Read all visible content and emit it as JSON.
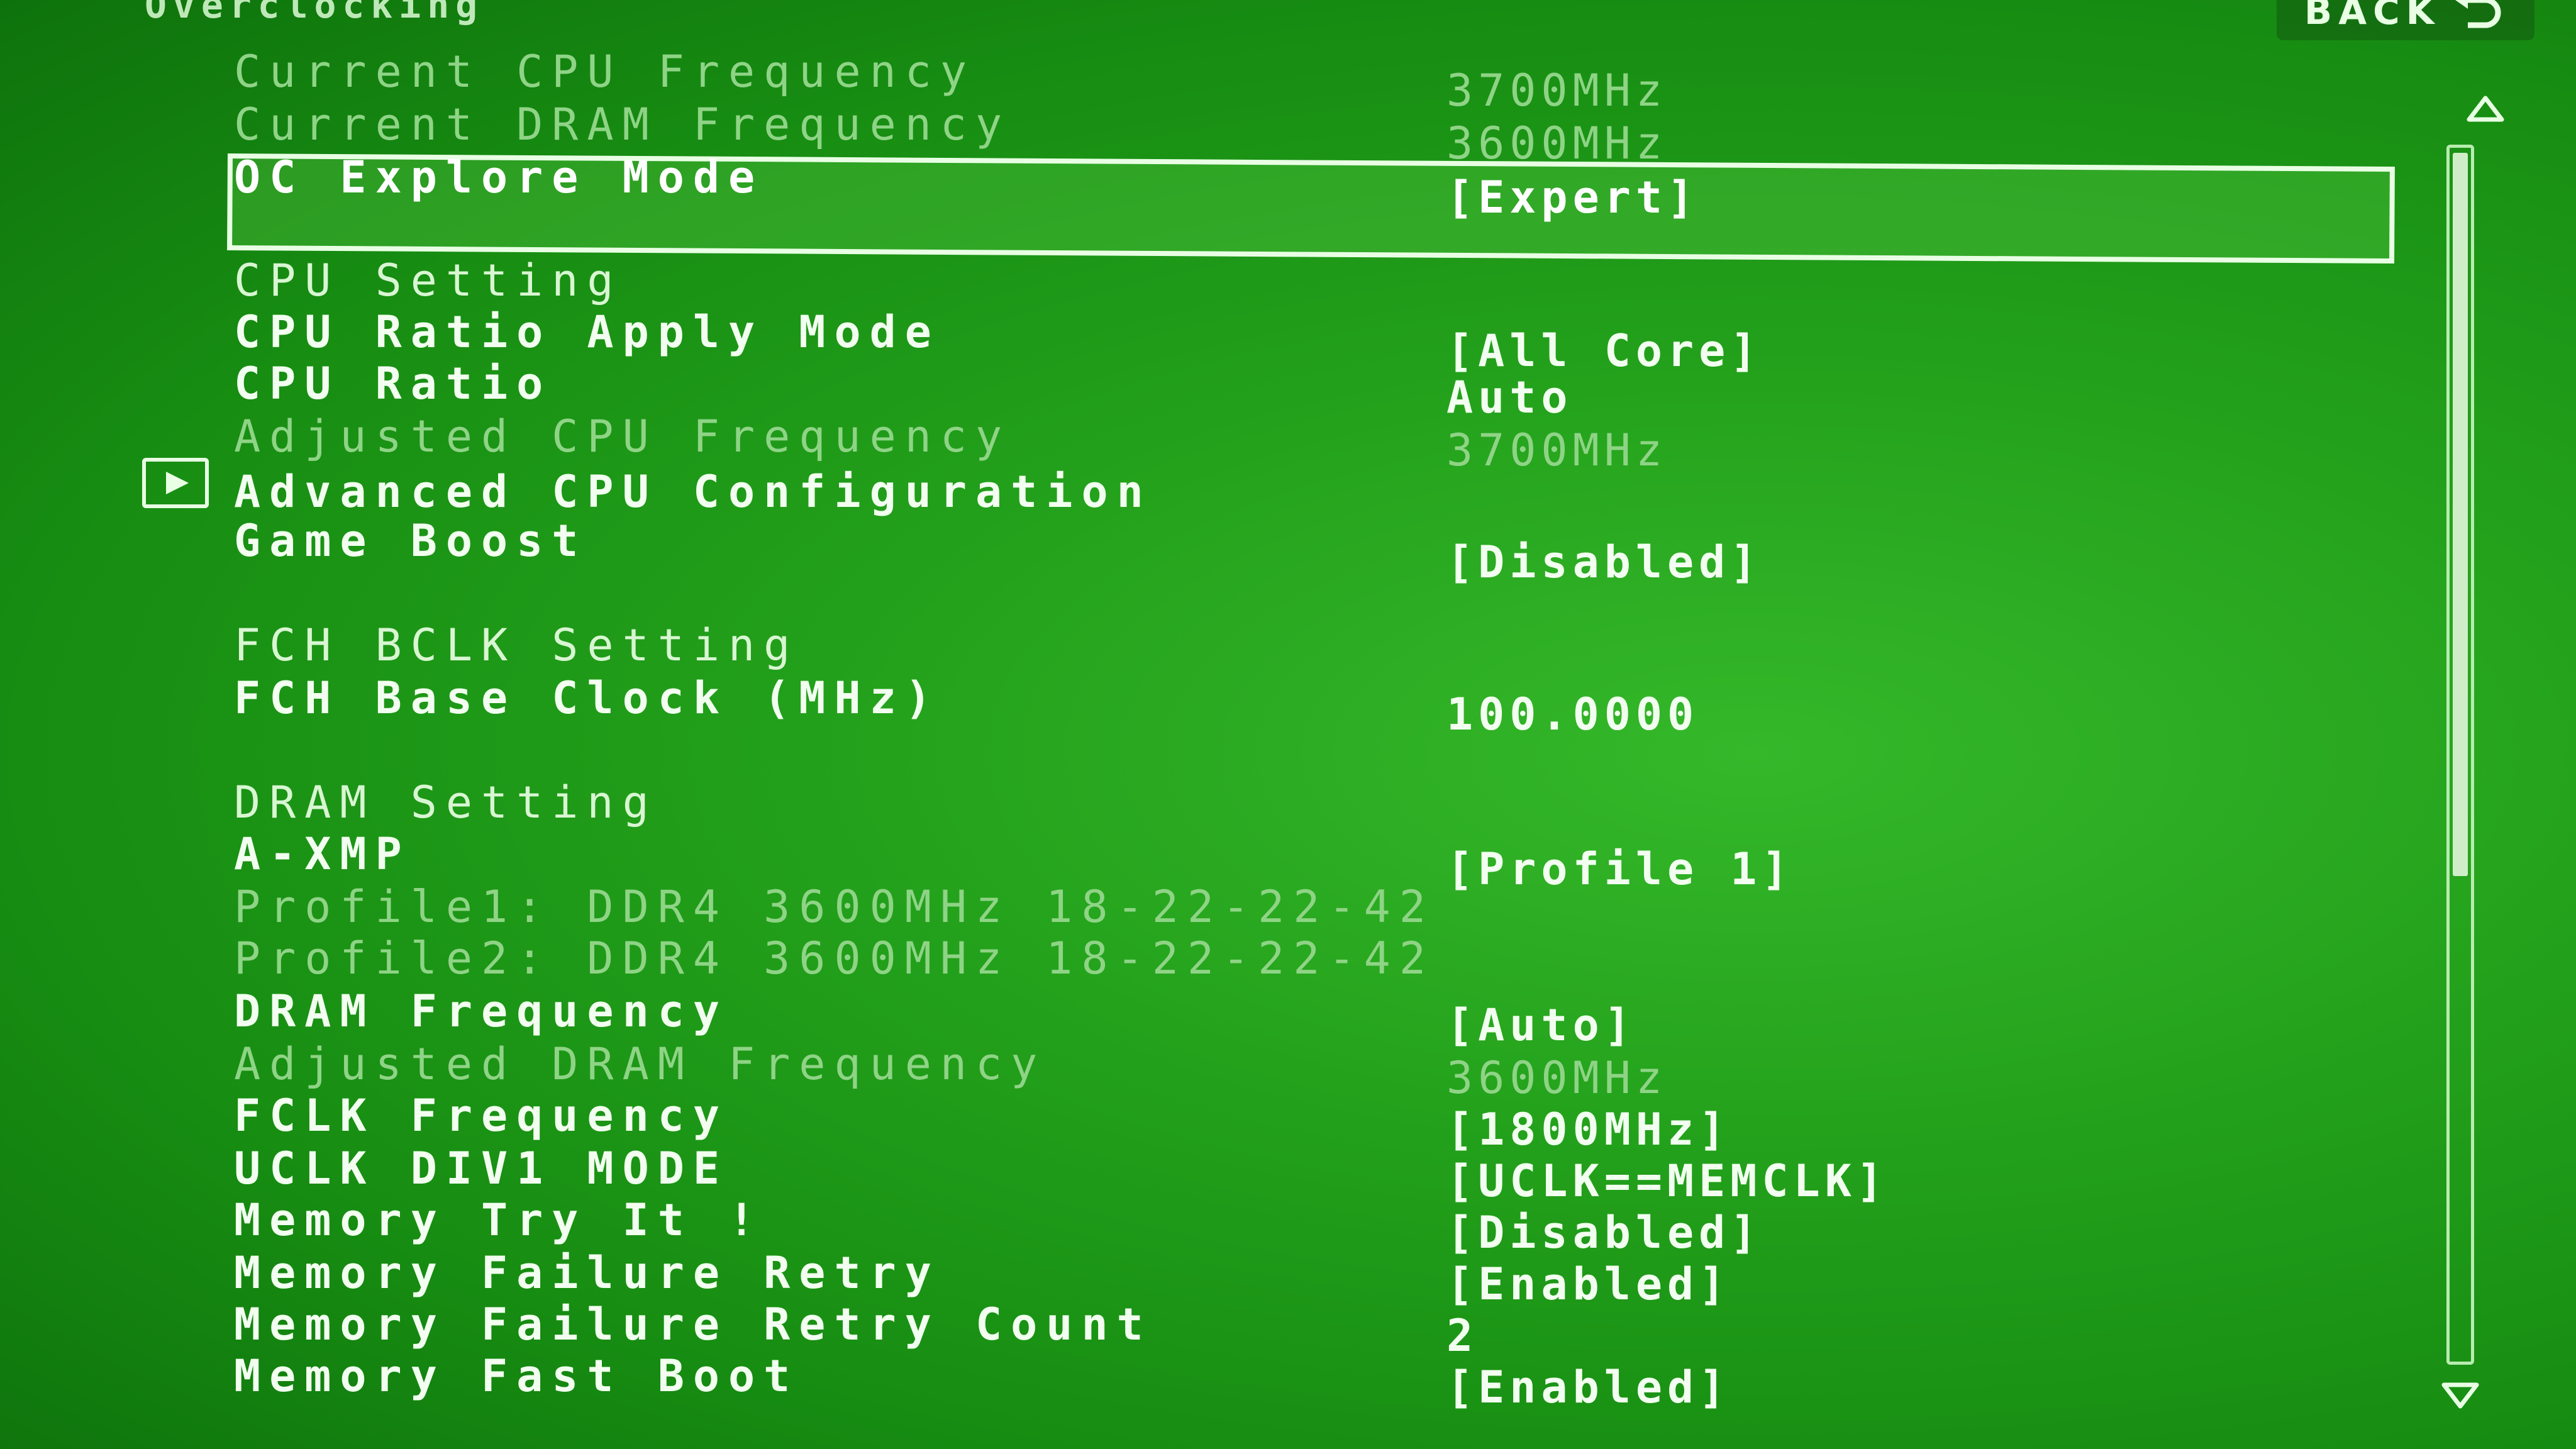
{
  "page": {
    "section_title": "Overclocking"
  },
  "back": {
    "label": "BACK"
  },
  "icons": {
    "back": "return-arrow-icon",
    "submenu": "submenu-arrow-icon",
    "scroll_up": "chevron-up-icon",
    "scroll_down": "chevron-down-icon"
  },
  "colors": {
    "background": "#1f9a18",
    "text": "#f2fff0",
    "dim_text": "#8fd486",
    "highlight_border": "#e8ffe4"
  },
  "rows": [
    {
      "label": "Current CPU Frequency",
      "value": "3700MHz"
    },
    {
      "label": "Current DRAM Frequency",
      "value": "3600MHz"
    },
    {
      "label": "OC Explore Mode",
      "value": "[Expert]"
    },
    {
      "label": "CPU Setting",
      "value": ""
    },
    {
      "label": "CPU Ratio Apply Mode",
      "value": "[All Core]"
    },
    {
      "label": "CPU Ratio",
      "value": "Auto"
    },
    {
      "label": "Adjusted CPU Frequency",
      "value": "3700MHz"
    },
    {
      "label": "Advanced CPU Configuration",
      "value": ""
    },
    {
      "label": "Game Boost",
      "value": "[Disabled]"
    },
    {
      "label": "FCH BCLK Setting",
      "value": ""
    },
    {
      "label": "FCH Base Clock (MHz)",
      "value": "100.0000"
    },
    {
      "label": "DRAM Setting",
      "value": ""
    },
    {
      "label": "A-XMP",
      "value": "[Profile 1]"
    },
    {
      "label": "Profile1: DDR4 3600MHz 18-22-22-42",
      "value": ""
    },
    {
      "label": "Profile2: DDR4 3600MHz 18-22-22-42",
      "value": ""
    },
    {
      "label": "DRAM Frequency",
      "value": "[Auto]"
    },
    {
      "label": "Adjusted DRAM Frequency",
      "value": "3600MHz"
    },
    {
      "label": "FCLK Frequency",
      "value": "[1800MHz]"
    },
    {
      "label": "UCLK DIV1 MODE",
      "value": "[UCLK==MEMCLK]"
    },
    {
      "label": "Memory Try It !",
      "value": "[Disabled]"
    },
    {
      "label": "Memory Failure Retry",
      "value": "[Enabled]"
    },
    {
      "label": "Memory Failure Retry Count",
      "value": "2"
    },
    {
      "label": "Memory Fast Boot",
      "value": "[Enabled]"
    }
  ]
}
